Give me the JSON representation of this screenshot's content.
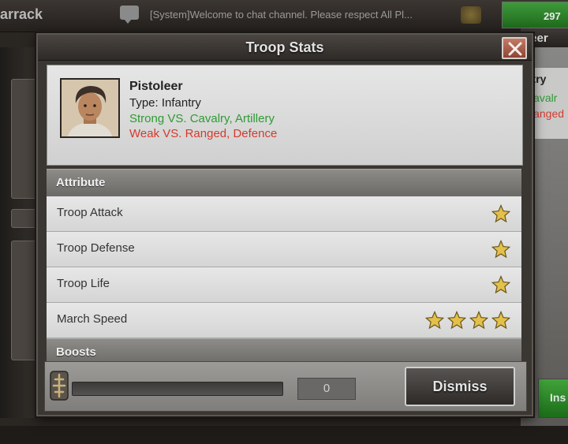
{
  "background": {
    "title": "arrack",
    "chat_text": "[System]Welcome to chat channel. Please respect All Pl...",
    "top_counter": "297",
    "right_panel_title": "leer",
    "right_type": "ntry",
    "right_strong": "Cavalr",
    "right_weak": "Ranged",
    "right_button": "Ins"
  },
  "dialog": {
    "title": "Troop Stats",
    "unit": {
      "name": "Pistoleer",
      "type": "Type: Infantry",
      "strong": "Strong VS. Cavalry, Artillery",
      "weak": "Weak VS. Ranged, Defence"
    },
    "sections": {
      "attribute": "Attribute",
      "boosts": "Boosts"
    },
    "attributes": [
      {
        "label": "Troop Attack",
        "stars": 1
      },
      {
        "label": "Troop Defense",
        "stars": 1
      },
      {
        "label": "Troop Life",
        "stars": 1
      },
      {
        "label": "March Speed",
        "stars": 4
      }
    ],
    "footer": {
      "count": "0",
      "slider_fraction": 0,
      "dismiss_label": "Dismiss"
    }
  },
  "colors": {
    "strong": "#2f9a34",
    "weak": "#d43a2f",
    "star": "#e2c04a",
    "close_button": "#b0604f"
  },
  "icons": {
    "close": "close-icon",
    "star": "star-icon",
    "chat": "chat-icon",
    "slider": "slider-handle-icon"
  }
}
